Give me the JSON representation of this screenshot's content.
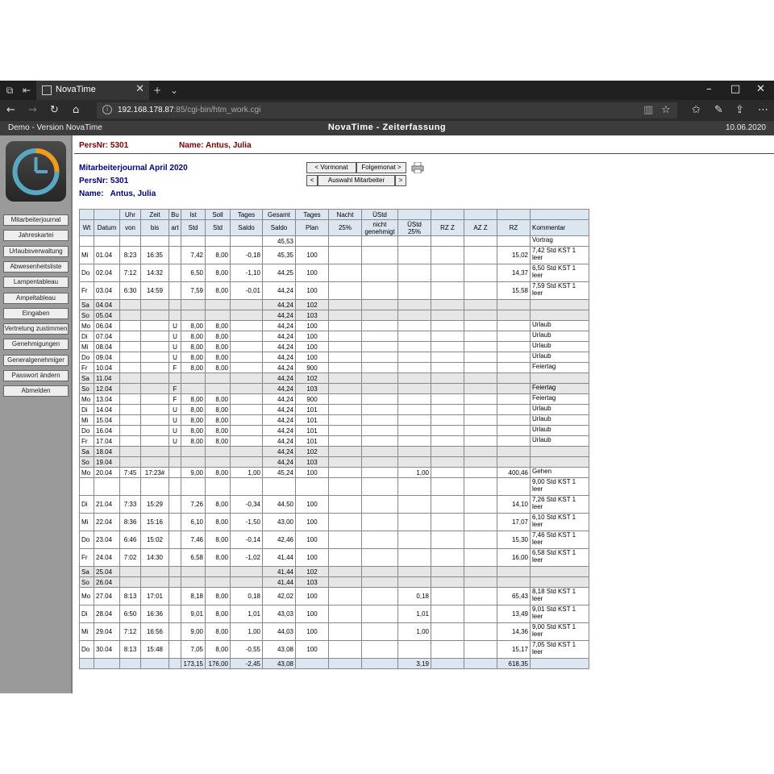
{
  "browser": {
    "tab_title": "NovaTime",
    "url_host": "192.168.178.87",
    "url_rest": ":85/cgi-bin/htm_work.cgi"
  },
  "app": {
    "demo_label": "Demo - Version NovaTime",
    "title": "NovaTime - Zeiterfassung",
    "date": "10.06.2020"
  },
  "sidebar": {
    "items": [
      "Mitarbeiterjournal",
      "Jahreskartei",
      "Urlaubsverwaltung",
      "Abwesenheitsliste",
      "Lampentableau",
      "Ampeltableau",
      "Eingaben",
      "Vertretung zustimmen",
      "Genehmigungen",
      "Generalgenehmiger",
      "Passwort ändern",
      "Abmelden"
    ]
  },
  "header": {
    "persnr": "PersNr: 5301",
    "name": "Name: Antus, Julia"
  },
  "journal": {
    "title": "Mitarbeiterjournal April 2020",
    "persnr": "PersNr: 5301",
    "name_label": "Name:",
    "name_value": "Antus, Julia",
    "btn_prev": "< Vormonat",
    "btn_next": "Folgemonat >",
    "btn_left": "<",
    "btn_select": "Auswahl Mitarbeiter",
    "btn_right": ">"
  },
  "table": {
    "head1": [
      "",
      "",
      "Uhr",
      "Zeit",
      "Bu",
      "Ist",
      "Soll",
      "Tages",
      "Gesamt",
      "Tages",
      "Nacht",
      "ÜStd",
      "",
      "",
      "",
      "",
      ""
    ],
    "head2": [
      "Wt",
      "Datum",
      "von",
      "bis",
      "art",
      "Std",
      "Std",
      "Saldo",
      "Saldo",
      "Plan",
      "25%",
      "nicht genehmigt",
      "ÜStd 25%",
      "RZ Z",
      "AZ Z",
      "RZ",
      "Kommentar"
    ],
    "rows": [
      {
        "c": [
          "",
          "",
          "",
          "",
          "",
          "",
          "",
          "",
          "45,53",
          "",
          "",
          "",
          "",
          "",
          "",
          "",
          "Vortrag"
        ],
        "t": "n"
      },
      {
        "c": [
          "Mi",
          "01.04",
          "8:23",
          "16:35",
          "",
          "7,42",
          "8,00",
          "-0,18",
          "45,35",
          "100",
          "",
          "",
          "",
          "",
          "",
          "15,02",
          "7,42 Std KST 1 leer"
        ],
        "t": "tall"
      },
      {
        "c": [
          "Do",
          "02.04",
          "7:12",
          "14:32",
          "",
          "6,50",
          "8,00",
          "-1,10",
          "44,25",
          "100",
          "",
          "",
          "",
          "",
          "",
          "14,37",
          "6,50 Std KST 1 leer"
        ],
        "t": "tall"
      },
      {
        "c": [
          "Fr",
          "03.04",
          "6:30",
          "14:59",
          "",
          "7,59",
          "8,00",
          "-0,01",
          "44,24",
          "100",
          "",
          "",
          "",
          "",
          "",
          "15,58",
          "7,59 Std KST 1 leer"
        ],
        "t": "tall"
      },
      {
        "c": [
          "Sa",
          "04.04",
          "",
          "",
          "",
          "",
          "",
          "",
          "44,24",
          "102",
          "",
          "",
          "",
          "",
          "",
          "",
          ""
        ],
        "t": "we"
      },
      {
        "c": [
          "So",
          "05.04",
          "",
          "",
          "",
          "",
          "",
          "",
          "44,24",
          "103",
          "",
          "",
          "",
          "",
          "",
          "",
          ""
        ],
        "t": "we"
      },
      {
        "c": [
          "Mo",
          "06.04",
          "",
          "",
          "U",
          "8,00",
          "8,00",
          "",
          "44,24",
          "100",
          "",
          "",
          "",
          "",
          "",
          "",
          "Urlaub"
        ],
        "t": "n"
      },
      {
        "c": [
          "Di",
          "07.04",
          "",
          "",
          "U",
          "8,00",
          "8,00",
          "",
          "44,24",
          "100",
          "",
          "",
          "",
          "",
          "",
          "",
          "Urlaub"
        ],
        "t": "n"
      },
      {
        "c": [
          "Mi",
          "08.04",
          "",
          "",
          "U",
          "8,00",
          "8,00",
          "",
          "44,24",
          "100",
          "",
          "",
          "",
          "",
          "",
          "",
          "Urlaub"
        ],
        "t": "n"
      },
      {
        "c": [
          "Do",
          "09.04",
          "",
          "",
          "U",
          "8,00",
          "8,00",
          "",
          "44,24",
          "100",
          "",
          "",
          "",
          "",
          "",
          "",
          "Urlaub"
        ],
        "t": "n"
      },
      {
        "c": [
          "Fr",
          "10.04",
          "",
          "",
          "F",
          "8,00",
          "8,00",
          "",
          "44,24",
          "900",
          "",
          "",
          "",
          "",
          "",
          "",
          "Feiertag"
        ],
        "t": "n"
      },
      {
        "c": [
          "Sa",
          "11.04",
          "",
          "",
          "",
          "",
          "",
          "",
          "44,24",
          "102",
          "",
          "",
          "",
          "",
          "",
          "",
          ""
        ],
        "t": "we"
      },
      {
        "c": [
          "So",
          "12.04",
          "",
          "",
          "F",
          "",
          "",
          "",
          "44,24",
          "103",
          "",
          "",
          "",
          "",
          "",
          "",
          "Feiertag"
        ],
        "t": "we"
      },
      {
        "c": [
          "Mo",
          "13.04",
          "",
          "",
          "F",
          "8,00",
          "8,00",
          "",
          "44,24",
          "900",
          "",
          "",
          "",
          "",
          "",
          "",
          "Feiertag"
        ],
        "t": "n"
      },
      {
        "c": [
          "Di",
          "14.04",
          "",
          "",
          "U",
          "8,00",
          "8,00",
          "",
          "44,24",
          "101",
          "",
          "",
          "",
          "",
          "",
          "",
          "Urlaub"
        ],
        "t": "n"
      },
      {
        "c": [
          "Mi",
          "15.04",
          "",
          "",
          "U",
          "8,00",
          "8,00",
          "",
          "44,24",
          "101",
          "",
          "",
          "",
          "",
          "",
          "",
          "Urlaub"
        ],
        "t": "n"
      },
      {
        "c": [
          "Do",
          "16.04",
          "",
          "",
          "U",
          "8,00",
          "8,00",
          "",
          "44,24",
          "101",
          "",
          "",
          "",
          "",
          "",
          "",
          "Urlaub"
        ],
        "t": "n"
      },
      {
        "c": [
          "Fr",
          "17.04",
          "",
          "",
          "U",
          "8,00",
          "8,00",
          "",
          "44,24",
          "101",
          "",
          "",
          "",
          "",
          "",
          "",
          "Urlaub"
        ],
        "t": "n"
      },
      {
        "c": [
          "Sa",
          "18.04",
          "",
          "",
          "",
          "",
          "",
          "",
          "44,24",
          "102",
          "",
          "",
          "",
          "",
          "",
          "",
          ""
        ],
        "t": "we"
      },
      {
        "c": [
          "So",
          "19.04",
          "",
          "",
          "",
          "",
          "",
          "",
          "44,24",
          "103",
          "",
          "",
          "",
          "",
          "",
          "",
          ""
        ],
        "t": "we"
      },
      {
        "c": [
          "Mo",
          "20.04",
          "7:45",
          "17:23#",
          "",
          "9,00",
          "8,00",
          "1,00",
          "45,24",
          "100",
          "",
          "",
          "1,00",
          "",
          "",
          "400,46",
          "Gehen"
        ],
        "t": "n"
      },
      {
        "c": [
          "",
          "",
          "",
          "",
          "",
          "",
          "",
          "",
          "",
          "",
          "",
          "",
          "",
          "",
          "",
          "",
          "9,00 Std KST 1 leer"
        ],
        "t": "tall"
      },
      {
        "c": [
          "Di",
          "21.04",
          "7:33",
          "15:29",
          "",
          "7,26",
          "8,00",
          "-0,34",
          "44,50",
          "100",
          "",
          "",
          "",
          "",
          "",
          "14,10",
          "7,26 Std KST 1 leer"
        ],
        "t": "tall"
      },
      {
        "c": [
          "Mi",
          "22.04",
          "8:36",
          "15:16",
          "",
          "6,10",
          "8,00",
          "-1,50",
          "43,00",
          "100",
          "",
          "",
          "",
          "",
          "",
          "17,07",
          "6,10 Std KST 1 leer"
        ],
        "t": "tall"
      },
      {
        "c": [
          "Do",
          "23.04",
          "6:46",
          "15:02",
          "",
          "7,46",
          "8,00",
          "-0,14",
          "42,46",
          "100",
          "",
          "",
          "",
          "",
          "",
          "15,30",
          "7,46 Std KST 1 leer"
        ],
        "t": "tall"
      },
      {
        "c": [
          "Fr",
          "24.04",
          "7:02",
          "14:30",
          "",
          "6,58",
          "8,00",
          "-1,02",
          "41,44",
          "100",
          "",
          "",
          "",
          "",
          "",
          "16,00",
          "6,58 Std KST 1 leer"
        ],
        "t": "tall"
      },
      {
        "c": [
          "Sa",
          "25.04",
          "",
          "",
          "",
          "",
          "",
          "",
          "41,44",
          "102",
          "",
          "",
          "",
          "",
          "",
          "",
          ""
        ],
        "t": "we"
      },
      {
        "c": [
          "So",
          "26.04",
          "",
          "",
          "",
          "",
          "",
          "",
          "41,44",
          "103",
          "",
          "",
          "",
          "",
          "",
          "",
          ""
        ],
        "t": "we"
      },
      {
        "c": [
          "Mo",
          "27.04",
          "8:13",
          "17:01",
          "",
          "8,18",
          "8,00",
          "0,18",
          "42,02",
          "100",
          "",
          "",
          "0,18",
          "",
          "",
          "65,43",
          "8,18 Std KST 1 leer"
        ],
        "t": "tall"
      },
      {
        "c": [
          "Di",
          "28.04",
          "6:50",
          "16:36",
          "",
          "9,01",
          "8,00",
          "1,01",
          "43,03",
          "100",
          "",
          "",
          "1,01",
          "",
          "",
          "13,49",
          "9,01 Std KST 1 leer"
        ],
        "t": "tall"
      },
      {
        "c": [
          "Mi",
          "29.04",
          "7:12",
          "16:56",
          "",
          "9,00",
          "8,00",
          "1,00",
          "44,03",
          "100",
          "",
          "",
          "1,00",
          "",
          "",
          "14,36",
          "9,00 Std KST 1 leer"
        ],
        "t": "tall"
      },
      {
        "c": [
          "Do",
          "30.04",
          "8:13",
          "15:48",
          "",
          "7,05",
          "8,00",
          "-0,55",
          "43,08",
          "100",
          "",
          "",
          "",
          "",
          "",
          "15,17",
          "7,05 Std KST 1 leer"
        ],
        "t": "tall"
      },
      {
        "c": [
          "",
          "",
          "",
          "",
          "",
          "173,15",
          "176,00",
          "-2,45",
          "43,08",
          "",
          "",
          "",
          "3,19",
          "",
          "",
          "618,35",
          ""
        ],
        "t": "total"
      }
    ]
  }
}
